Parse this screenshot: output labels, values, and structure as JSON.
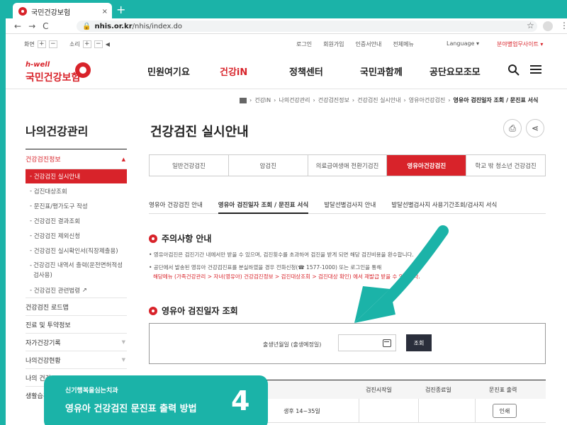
{
  "browser": {
    "tab_title": "국민건강보험",
    "tab_close": "×",
    "new_tab": "+",
    "url_domain": "nhis.or.kr",
    "url_path": "/nhis/index.do",
    "back": "←",
    "forward": "→",
    "reload": "C",
    "star": "☆",
    "menu": "⋮"
  },
  "utility": {
    "screen_label": "화면",
    "sound_label": "소리",
    "plus": "+",
    "minus": "−",
    "links": [
      "로그인",
      "회원가입",
      "인증서안내",
      "전체메뉴"
    ],
    "language": "Language ▾",
    "branch": "분야별업무사이트 ▾"
  },
  "header": {
    "logo_small": "h-well",
    "logo_name": "국민건강보험",
    "nav": [
      "민원여기요",
      "건강iN",
      "정책센터",
      "국민과함께",
      "공단요모조모"
    ],
    "active_index": 1
  },
  "breadcrumb": [
    "건강iN",
    "나의건강관리",
    "건강검진정보",
    "건강검진 실시안내",
    "영유아건강검진",
    "영유아 검진일자 조회 / 문진표 서식"
  ],
  "sidebar": {
    "title": "나의건강관리",
    "section": "건강검진정보",
    "section_arrow": "▲",
    "sub_items": [
      "건강검진 실시안내",
      "검진대상조회",
      "문진표/평가도구 작성",
      "건강검진 결과조회",
      "건강검진 제외신청",
      "건강검진 실시확인서(직장제출용)",
      "건강검진 내역서 출력(운전면허적성검사용)",
      "건강검진 관련법령"
    ],
    "top_items": [
      "건강검진 로드맵",
      "진료 및 투약정보",
      "자가건강기록",
      "나의건강현황",
      "나의 건강",
      "생활습관"
    ],
    "arrow": "▼"
  },
  "content": {
    "title": "건강검진 실시안내",
    "tabs": [
      "일반건강검진",
      "암검진",
      "의료급여생애 전환기검진",
      "영유아건강검진",
      "학교 밖 청소년 건강검진"
    ],
    "active_tab": 3,
    "subtabs": [
      "영유아 건강검진 안내",
      "영유아 검진일자 조회 / 문진표 서식",
      "발달선별검사지 안내",
      "발달선별검사지 사용기간조회/검사지 서식"
    ],
    "active_subtab": 1,
    "notice_title": "주의사항 안내",
    "notice_lines": [
      "• 영유아검진은 검진기간 내에서만 받을 수 있으며, 검진횟수를 초과하여 검진을 받게 되면 해당 검진비용을 환수합니다.",
      "• 공단에서 발송된 영유아 건강검진표를 분실하였을 경우 전화신청(☎ 1577-1000) 또는 로그인을 통해"
    ],
    "notice_red": "해당메뉴 (가족건강관리 > 자녀(영유아) 건강검진정보 > 검진대상조회 > 검진대상 확인) 에서 재발급 받을 수 있습니다.",
    "query_title": "영유아 검진일자 조회",
    "birth_label": "출생년월일 (출생예정일)",
    "search_button": "조회",
    "table_headers": [
      "검진시작일",
      "검진종료일",
      "문진표 출력"
    ],
    "row_age": "생후 14~35일",
    "print_button": "인쇄"
  },
  "banner": {
    "subtitle": "신기행복을심는치과",
    "title": "영유아 건강검진 문진표 출력 방법",
    "step": "4"
  },
  "colors": {
    "accent": "#d8232a",
    "teal": "#1bb3a8",
    "dark_button": "#2a2e3b"
  }
}
